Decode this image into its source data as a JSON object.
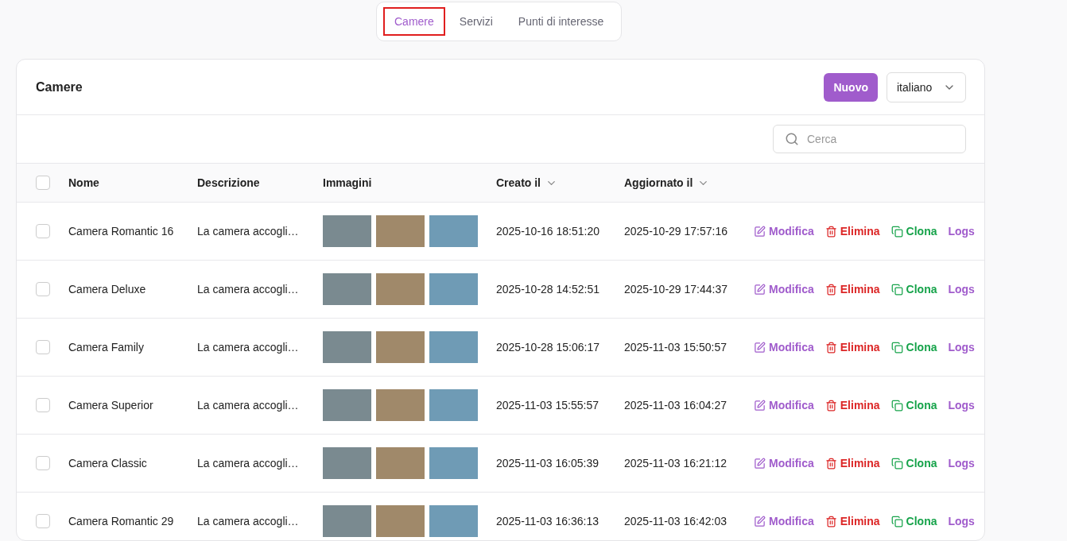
{
  "tabs": [
    {
      "label": "Camere",
      "selected": true
    },
    {
      "label": "Servizi",
      "selected": false
    },
    {
      "label": "Punti di interesse",
      "selected": false
    }
  ],
  "card": {
    "title": "Camere",
    "new_button": "Nuovo",
    "language": "italiano",
    "search": {
      "placeholder": "Cerca"
    }
  },
  "table": {
    "select_all_checked": false,
    "columns": [
      {
        "label": "Nome",
        "sortable": false
      },
      {
        "label": "Descrizione",
        "sortable": false
      },
      {
        "label": "Immagini",
        "sortable": false
      },
      {
        "label": "Creato il",
        "sortable": true
      },
      {
        "label": "Aggiornato il",
        "sortable": true
      }
    ],
    "rows": [
      {
        "checked": false,
        "name": "Camera Romantic 16",
        "description": "La camera accogli…",
        "created": "2025-10-16 18:51:20",
        "updated": "2025-10-29 17:57:16",
        "actions": [
          {
            "kind": "edit",
            "label": "Modifica"
          },
          {
            "kind": "delete",
            "label": "Elimina"
          },
          {
            "kind": "clone",
            "label": "Clona"
          },
          {
            "kind": "logs",
            "label": "Logs"
          }
        ]
      },
      {
        "checked": false,
        "name": "Camera Deluxe",
        "description": "La camera accogli…",
        "created": "2025-10-28 14:52:51",
        "updated": "2025-10-29 17:44:37",
        "actions": [
          {
            "kind": "edit",
            "label": "Modifica"
          },
          {
            "kind": "delete",
            "label": "Elimina"
          },
          {
            "kind": "clone",
            "label": "Clona"
          },
          {
            "kind": "logs",
            "label": "Logs"
          }
        ]
      },
      {
        "checked": false,
        "name": "Camera Family",
        "description": "La camera accogli…",
        "created": "2025-10-28 15:06:17",
        "updated": "2025-11-03 15:50:57",
        "actions": [
          {
            "kind": "edit",
            "label": "Modifica"
          },
          {
            "kind": "delete",
            "label": "Elimina"
          },
          {
            "kind": "clone",
            "label": "Clona"
          },
          {
            "kind": "logs",
            "label": "Logs"
          }
        ]
      },
      {
        "checked": false,
        "name": "Camera Superior",
        "description": "La camera accogli…",
        "created": "2025-11-03 15:55:57",
        "updated": "2025-11-03 16:04:27",
        "actions": [
          {
            "kind": "edit",
            "label": "Modifica"
          },
          {
            "kind": "delete",
            "label": "Elimina"
          },
          {
            "kind": "clone",
            "label": "Clona"
          },
          {
            "kind": "logs",
            "label": "Logs"
          }
        ]
      },
      {
        "checked": false,
        "name": "Camera Classic",
        "description": "La camera accogli…",
        "created": "2025-11-03 16:05:39",
        "updated": "2025-11-03 16:21:12",
        "actions": [
          {
            "kind": "edit",
            "label": "Modifica"
          },
          {
            "kind": "delete",
            "label": "Elimina"
          },
          {
            "kind": "clone",
            "label": "Clona"
          },
          {
            "kind": "logs",
            "label": "Logs"
          }
        ]
      },
      {
        "checked": false,
        "name": "Camera Romantic 29",
        "description": "La camera accogli…",
        "created": "2025-11-03 16:36:13",
        "updated": "2025-11-03 16:42:03",
        "actions": [
          {
            "kind": "edit",
            "label": "Modifica"
          },
          {
            "kind": "delete",
            "label": "Elimina"
          },
          {
            "kind": "clone",
            "label": "Clona"
          },
          {
            "kind": "logs",
            "label": "Logs"
          }
        ]
      }
    ]
  }
}
